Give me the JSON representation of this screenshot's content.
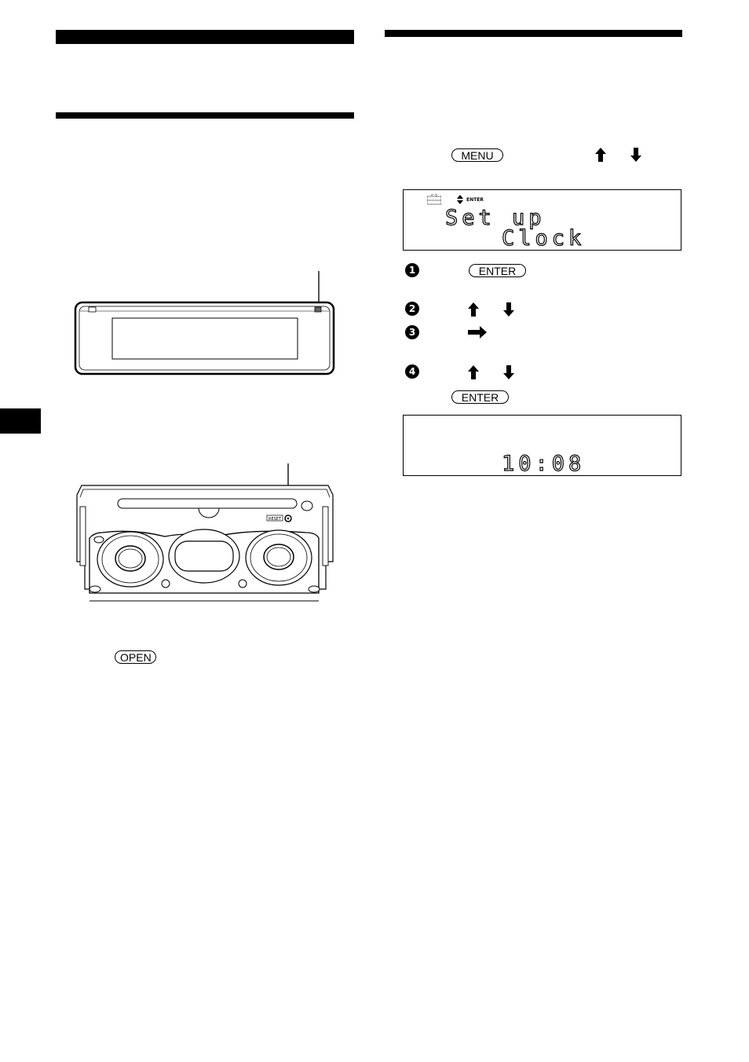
{
  "page": {
    "side_tab": {
      "label": ""
    }
  },
  "left_column": {
    "faceplate_figure": {
      "name": "front-panel-faceplate"
    },
    "unit_figure": {
      "reset_label": "RESET"
    },
    "open_button_label": "OPEN"
  },
  "right_column": {
    "menu_button_label": "MENU",
    "arrows": {
      "up": "up-arrow",
      "down": "down-arrow",
      "right": "right-arrow"
    },
    "lcd_setup": {
      "icon_setup": "setup-toolbox-icon",
      "icon_updown": "updown-indicator-icon",
      "enter_indicator": "ENTER",
      "line1": "Set up",
      "line2": "Clock"
    },
    "steps": [
      {
        "number": "1",
        "button_label": "ENTER"
      },
      {
        "number": "2"
      },
      {
        "number": "3"
      },
      {
        "number": "4",
        "button_label": "ENTER"
      }
    ],
    "lcd_clock": {
      "time": "10:08"
    }
  }
}
